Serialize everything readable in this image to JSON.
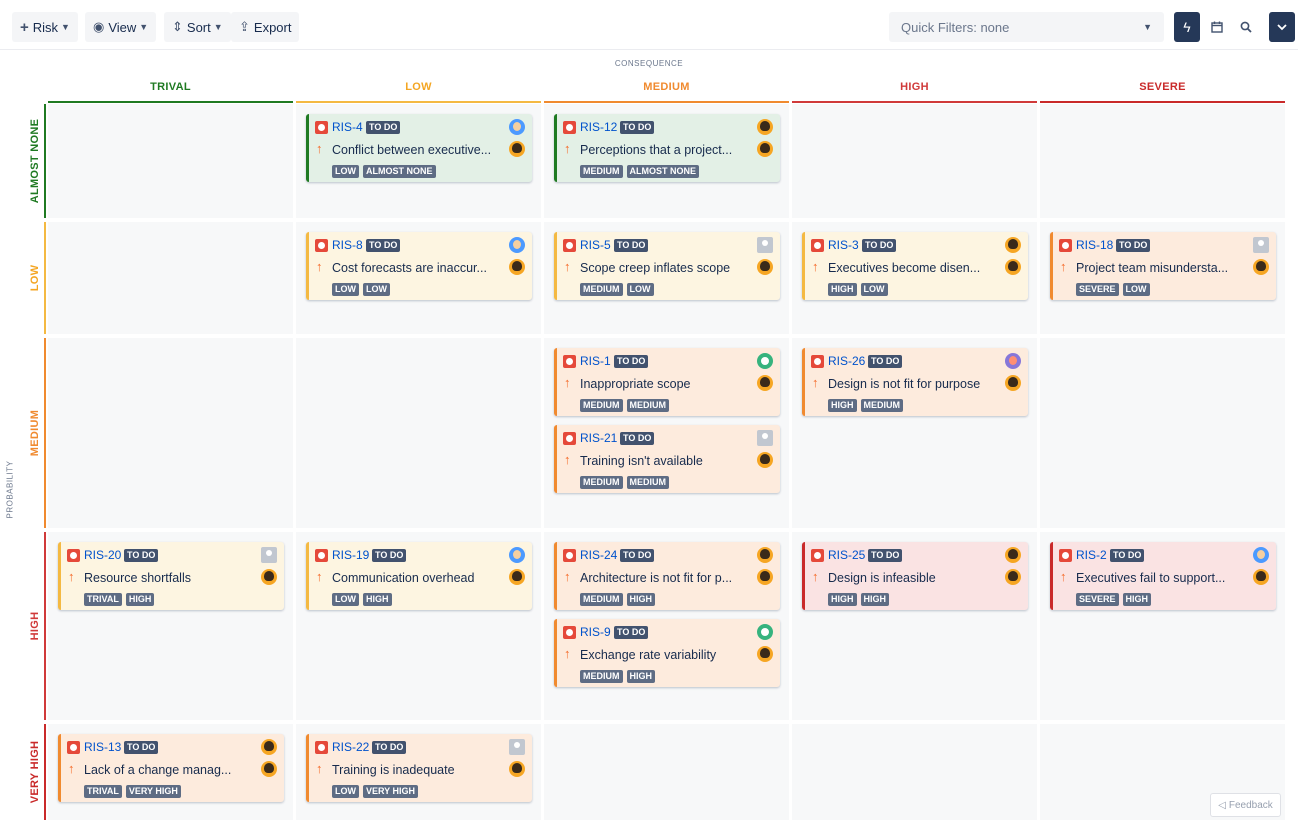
{
  "toolbar": {
    "risk_label": "Risk",
    "view_label": "View",
    "sort_label": "Sort",
    "export_label": "Export",
    "quick_filters": "Quick Filters: none",
    "icons": [
      "plus-icon",
      "eye-icon",
      "sort-icon",
      "export-icon",
      "lightning-icon",
      "calendar-icon",
      "search-icon",
      "chevron-down-icon"
    ]
  },
  "axes": {
    "consequence_label": "CONSEQUENCE",
    "probability_label": "PROBABILITY",
    "columns": [
      {
        "label": "TRIVAL",
        "color": "#1f7a22"
      },
      {
        "label": "LOW",
        "color": "#f4b942"
      },
      {
        "label": "MEDIUM",
        "color": "#f08a2f"
      },
      {
        "label": "HIGH",
        "color": "#d03a3a"
      },
      {
        "label": "SEVERE",
        "color": "#c92a2a"
      }
    ],
    "rows": [
      {
        "label": "ALMOST NONE",
        "color": "#1f7a22"
      },
      {
        "label": "LOW",
        "color": "#f4b942"
      },
      {
        "label": "MEDIUM",
        "color": "#f08a2f"
      },
      {
        "label": "HIGH",
        "color": "#d03a3a"
      },
      {
        "label": "VERY HIGH",
        "color": "#c92a2a"
      }
    ]
  },
  "cards": [
    {
      "key": "RIS-4",
      "status": "TO DO",
      "summary": "Conflict between executive...",
      "consequence": "LOW",
      "probability": "ALMOST NONE",
      "avatar": "blue"
    },
    {
      "key": "RIS-12",
      "status": "TO DO",
      "summary": "Perceptions that a project...",
      "consequence": "MEDIUM",
      "probability": "ALMOST NONE",
      "avatar": "dark"
    },
    {
      "key": "RIS-8",
      "status": "TO DO",
      "summary": "Cost forecasts are inaccur...",
      "consequence": "LOW",
      "probability": "LOW",
      "avatar": "blue"
    },
    {
      "key": "RIS-5",
      "status": "TO DO",
      "summary": "Scope creep inflates scope",
      "consequence": "MEDIUM",
      "probability": "LOW",
      "avatar": "grey"
    },
    {
      "key": "RIS-3",
      "status": "TO DO",
      "summary": "Executives become disen...",
      "consequence": "HIGH",
      "probability": "LOW",
      "avatar": "dark"
    },
    {
      "key": "RIS-18",
      "status": "TO DO",
      "summary": "Project team misundersta...",
      "consequence": "SEVERE",
      "probability": "LOW",
      "avatar": "grey"
    },
    {
      "key": "RIS-1",
      "status": "TO DO",
      "summary": "Inappropriate scope",
      "consequence": "MEDIUM",
      "probability": "MEDIUM",
      "avatar": "teal"
    },
    {
      "key": "RIS-21",
      "status": "TO DO",
      "summary": "Training isn't available",
      "consequence": "MEDIUM",
      "probability": "MEDIUM",
      "avatar": "grey"
    },
    {
      "key": "RIS-26",
      "status": "TO DO",
      "summary": "Design is not fit for purpose",
      "consequence": "HIGH",
      "probability": "MEDIUM",
      "avatar": "purple"
    },
    {
      "key": "RIS-20",
      "status": "TO DO",
      "summary": "Resource shortfalls",
      "consequence": "TRIVAL",
      "probability": "HIGH",
      "avatar": "grey"
    },
    {
      "key": "RIS-19",
      "status": "TO DO",
      "summary": "Communication overhead",
      "consequence": "LOW",
      "probability": "HIGH",
      "avatar": "blue"
    },
    {
      "key": "RIS-24",
      "status": "TO DO",
      "summary": "Architecture is not fit for p...",
      "consequence": "MEDIUM",
      "probability": "HIGH",
      "avatar": "dark"
    },
    {
      "key": "RIS-9",
      "status": "TO DO",
      "summary": "Exchange rate variability",
      "consequence": "MEDIUM",
      "probability": "HIGH",
      "avatar": "teal"
    },
    {
      "key": "RIS-25",
      "status": "TO DO",
      "summary": "Design is infeasible",
      "consequence": "HIGH",
      "probability": "HIGH",
      "avatar": "dark"
    },
    {
      "key": "RIS-2",
      "status": "TO DO",
      "summary": "Executives fail to support...",
      "consequence": "SEVERE",
      "probability": "HIGH",
      "avatar": "blue"
    },
    {
      "key": "RIS-13",
      "status": "TO DO",
      "summary": "Lack of a change manag...",
      "consequence": "TRIVAL",
      "probability": "VERY HIGH",
      "avatar": "dark"
    },
    {
      "key": "RIS-22",
      "status": "TO DO",
      "summary": "Training is inadequate",
      "consequence": "LOW",
      "probability": "VERY HIGH",
      "avatar": "grey"
    }
  ],
  "feedback_label": "Feedback"
}
